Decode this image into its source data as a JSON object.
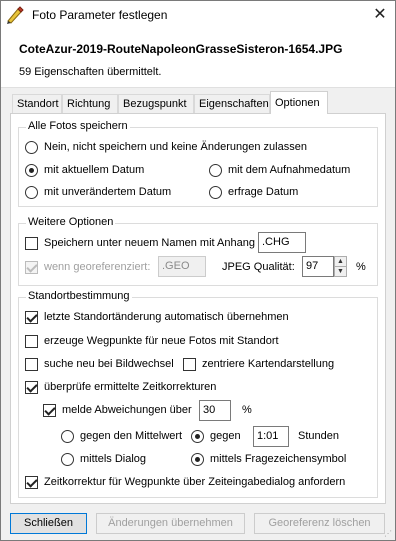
{
  "window": {
    "title": "Foto Parameter festlegen",
    "close_glyph": "✕"
  },
  "header": {
    "filename": "CoteAzur-2019-RouteNapoleonGrasseSisteron-1654.JPG",
    "subline": "59 Eigenschaften übermittelt."
  },
  "tabs": [
    {
      "label": "Standort",
      "active": false
    },
    {
      "label": "Richtung",
      "active": false
    },
    {
      "label": "Bezugspunkt",
      "active": false
    },
    {
      "label": "Eigenschaften",
      "active": false
    },
    {
      "label": "Optionen",
      "active": true
    }
  ],
  "alle_fotos": {
    "legend": "Alle Fotos speichern",
    "opt_nein": "Nein, nicht speichern und keine Änderungen zulassen",
    "opt_aktuell": "mit aktuellem Datum",
    "opt_aufnahme": "mit dem Aufnahmedatum",
    "opt_unveraendert": "mit unverändertem Datum",
    "opt_erfrage": "erfrage Datum",
    "selected": "mit aktuellem Datum"
  },
  "weitere": {
    "legend": "Weitere Optionen",
    "speichern_label": "Speichern unter neuem Namen mit Anhang",
    "speichern_checked": false,
    "anhang_value": ".CHG",
    "georef_label": "wenn georeferenziert:",
    "georef_checked": true,
    "georef_value": ".GEO",
    "jpeg_label": "JPEG Qualität:",
    "jpeg_value": "97",
    "jpeg_unit": "%"
  },
  "standort": {
    "legend": "Standortbestimmung",
    "letzte_label": "letzte Standortänderung automatisch übernehmen",
    "letzte_checked": true,
    "wegpunkte_label": "erzeuge Wegpunkte für neue Fotos mit Standort",
    "wegpunkte_checked": false,
    "suche_label": "suche neu bei Bildwechsel",
    "suche_checked": false,
    "zentriere_label": "zentriere Kartendarstellung",
    "zentriere_checked": false,
    "pruefe_label": "überprüfe ermittelte Zeitkorrekturen",
    "pruefe_checked": true,
    "melde_label": "melde Abweichungen über",
    "melde_checked": true,
    "melde_value": "30",
    "melde_unit": "%",
    "mittelwert_label": "gegen den Mittelwert",
    "gegen_label": "gegen",
    "gegen_value": "1:01",
    "stunden_label": "Stunden",
    "mittelwert_selected": "gegen",
    "dialog_label": "mittels Dialog",
    "symbol_label": "mittels Fragezeichensymbol",
    "mittel_selected": "mittels Fragezeichensymbol",
    "zeitkorrektur_label": "Zeitkorrektur für Wegpunkte über Zeiteingabedialog anfordern",
    "zeitkorrektur_checked": true
  },
  "buttons": {
    "close": "Schließen",
    "apply": "Änderungen übernehmen",
    "delete": "Georeferenz löschen"
  },
  "colors": {
    "accent": "#0078d7",
    "icon_yellow": "#e8c43a"
  }
}
